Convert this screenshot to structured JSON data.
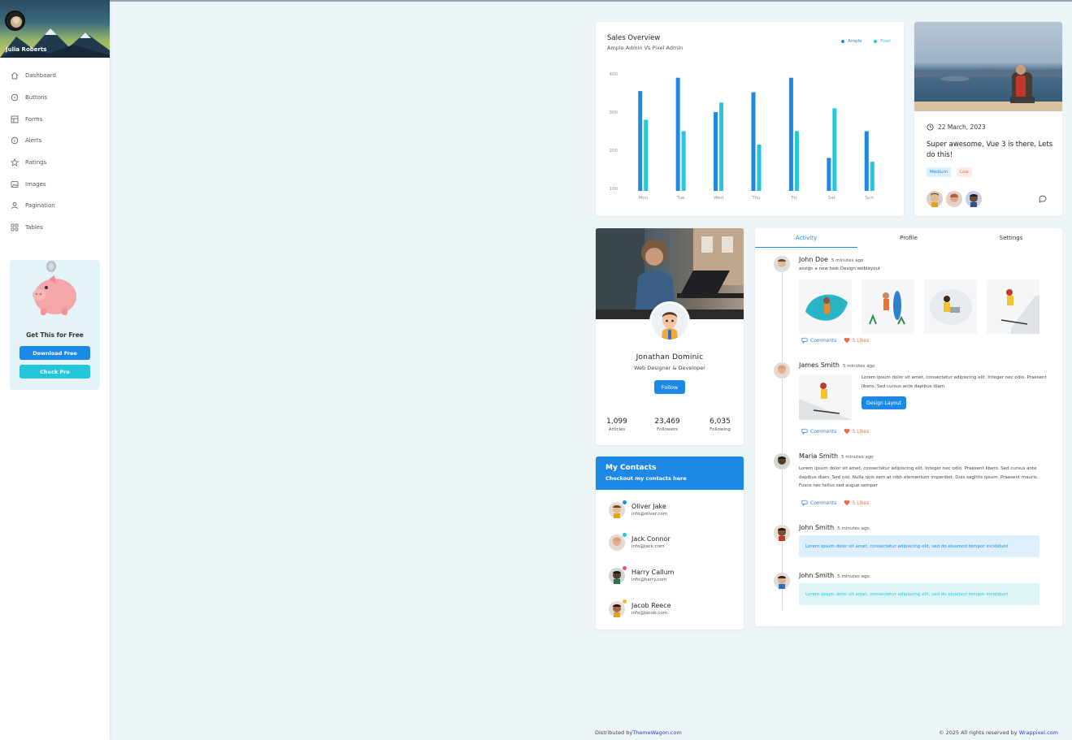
{
  "sidebar": {
    "user_name": "Julia Roberts",
    "items": [
      {
        "label": "Dashboard",
        "icon": "home-icon"
      },
      {
        "label": "Buttons",
        "icon": "circle-icon"
      },
      {
        "label": "Forms",
        "icon": "table-icon"
      },
      {
        "label": "Alerts",
        "icon": "info-icon"
      },
      {
        "label": "Ratings",
        "icon": "star-icon"
      },
      {
        "label": "Images",
        "icon": "image-icon"
      },
      {
        "label": "Pagination",
        "icon": "user-icon"
      },
      {
        "label": "Tables",
        "icon": "grid-icon"
      }
    ],
    "promo": {
      "title": "Get This for Free",
      "download_label": "Download Free",
      "pro_label": "Check Pro"
    }
  },
  "sales": {
    "title": "Sales Overview",
    "subtitle": "Ample Admin Vs Pixel Admin",
    "legend": [
      "Ample",
      "Pixel"
    ]
  },
  "chart_data": {
    "type": "bar",
    "title": "Sales Overview",
    "subtitle": "Ample Admin Vs Pixel Admin",
    "categories": [
      "Mon",
      "Tue",
      "Wed",
      "Thu",
      "Fri",
      "Sat",
      "Sun"
    ],
    "series": [
      {
        "name": "Ample",
        "values": [
          355,
          390,
          300,
          352,
          390,
          180,
          250
        ]
      },
      {
        "name": "Pixel",
        "values": [
          280,
          250,
          325,
          215,
          250,
          310,
          170
        ]
      }
    ],
    "yticks": [
      "100",
      "200",
      "300",
      "400"
    ],
    "ylim": [
      100,
      400
    ],
    "colors": [
      "#1e88e5",
      "#26c6da"
    ],
    "legend_position": "top-right",
    "grid": false
  },
  "blog": {
    "date": "22 March, 2023",
    "text": "Super awesome, Vue 3 is there, Lets do this!",
    "tags": [
      "Medium",
      "Low"
    ]
  },
  "profile": {
    "name": "Jonathan Dominic",
    "role": "Web Designer & Developer",
    "follow_label": "Follow",
    "stats": [
      {
        "value": "1,099",
        "label": "Articles"
      },
      {
        "value": "23,469",
        "label": "Followers"
      },
      {
        "value": "6,035",
        "label": "Following"
      }
    ]
  },
  "contacts": {
    "title": "My Contacts",
    "subtitle": "Checkout my contacts here",
    "items": [
      {
        "name": "Oliver Jake",
        "email": "info@oliver.com",
        "status_color": "#1e88e5"
      },
      {
        "name": "Jack Connor",
        "email": "info@jack.com",
        "status_color": "#26c6da"
      },
      {
        "name": "Harry Callum",
        "email": "info@harry.com",
        "status_color": "#fc4b6c"
      },
      {
        "name": "Jacob Reece",
        "email": "info@jacob.com",
        "status_color": "#ffb22b"
      }
    ]
  },
  "activity": {
    "tabs": [
      "Activity",
      "Profile",
      "Settings"
    ],
    "comments_label": "Comments",
    "likes_label": "5 Likes",
    "entries": [
      {
        "name": "John Doe",
        "time": "5 minutes ago",
        "text": "assign a new task Design weblayout"
      },
      {
        "name": "James Smith",
        "time": "5 minutes ago",
        "text": "Lorem ipsum dolor sit amet, consectetur adipiscing elit. Integer nec odio. Praesent libero. Sed cursus ante dapibus diam.",
        "button": "Design Layout"
      },
      {
        "name": "Maria Smith",
        "time": "5 minutes ago",
        "text": "Lorem ipsum dolor sit amet, consectetur adipiscing elit. Integer nec odio. Praesent libero. Sed cursus ante dapibus diam. Sed nisi. Nulla quis sem at nibh elementum imperdiet. Duis sagittis ipsum. Praesent mauris. Fusce nec tellus sed augue semper"
      },
      {
        "name": "John Smith",
        "time": "5 minutes ago",
        "text": "Lorem ipsum dolor sit amet, consectetur adipiscing elit, sed do eiusmod tempor incididunt"
      },
      {
        "name": "John Smith",
        "time": "5 minutes ago",
        "text": "Lorem ipsum dolor sit amet, consectetur adipiscing elit, sed do eiusmod tempor incididunt"
      }
    ]
  },
  "footer": {
    "left_prefix": "Distributed by",
    "left_link": "ThemeWagon.com",
    "right_prefix": "© 2025 All rights reserved by",
    "right_link": "Wrappixel.com"
  }
}
